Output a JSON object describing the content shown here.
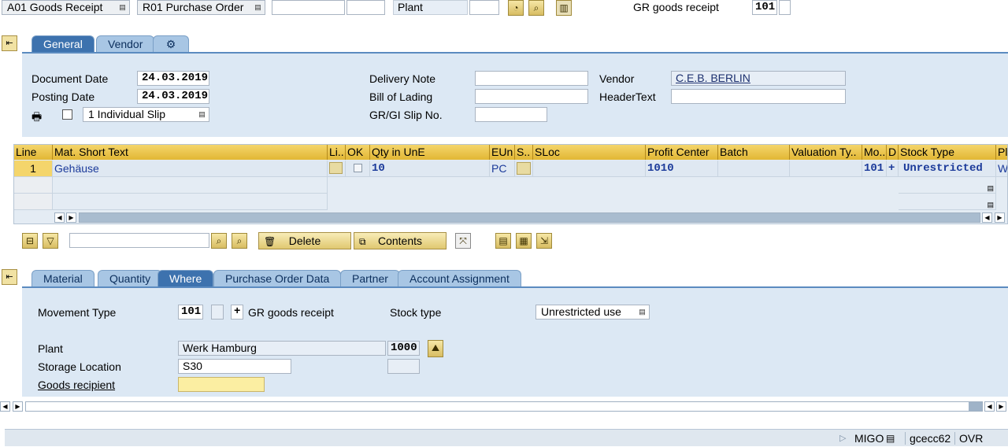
{
  "topbar": {
    "doc_action": "A01 Goods Receipt",
    "ref_doc": "R01 Purchase Order",
    "ref_input1": "",
    "ref_input2": "",
    "plant_label": "Plant",
    "plant_value": "",
    "mvt_label": "GR goods receipt",
    "mvt_value": "101"
  },
  "header": {
    "tabs": [
      "General",
      "Vendor"
    ],
    "document_date_label": "Document Date",
    "document_date": "24.03.2019",
    "posting_date_label": "Posting Date",
    "posting_date": "24.03.2019",
    "slip_option": "1 Individual Slip",
    "delivery_note_label": "Delivery Note",
    "delivery_note": "",
    "bill_of_lading_label": "Bill of Lading",
    "bill_of_lading": "",
    "gr_slip_label": "GR/GI Slip No.",
    "gr_slip": "",
    "vendor_label": "Vendor",
    "vendor": "C.E.B. BERLIN",
    "header_text_label": "HeaderText",
    "header_text": ""
  },
  "items": {
    "columns": [
      "Line",
      "Mat. Short Text",
      "Li..",
      "OK",
      "Qty in UnE",
      "EUn",
      "S..",
      "SLoc",
      "Profit Center",
      "Batch",
      "Valuation Ty..",
      "Mo..",
      "D",
      "Stock Type",
      "Pl"
    ],
    "rows": [
      {
        "line": "1",
        "text": "Gehäuse",
        "qty": "10",
        "eun": "PC",
        "profit_center": "1010",
        "mvt": "101",
        "d": "+",
        "stock_type": "Unrestricted",
        "pl": "W"
      }
    ]
  },
  "item_toolbar": {
    "search_value": "",
    "delete_label": "Delete",
    "contents_label": "Contents"
  },
  "detail": {
    "tabs": [
      "Material",
      "Quantity",
      "Where",
      "Purchase Order Data",
      "Partner",
      "Account Assignment"
    ],
    "movement_type_label": "Movement Type",
    "movement_type": "101",
    "movement_sign": "+",
    "movement_text": "GR goods receipt",
    "stock_type_label": "Stock type",
    "stock_type": "Unrestricted use",
    "plant_label": "Plant",
    "plant_name": "Werk Hamburg",
    "plant_code": "1000",
    "storage_location_label": "Storage Location",
    "storage_location": "S30",
    "goods_recipient_label": "Goods recipient",
    "goods_recipient": ""
  },
  "status": {
    "transaction": "MIGO",
    "system": "gcecc62",
    "mode": "OVR"
  },
  "colors": {
    "panel": "#dce8f4",
    "tab_active": "#3d72ae",
    "grid_header": "#e2b734"
  }
}
